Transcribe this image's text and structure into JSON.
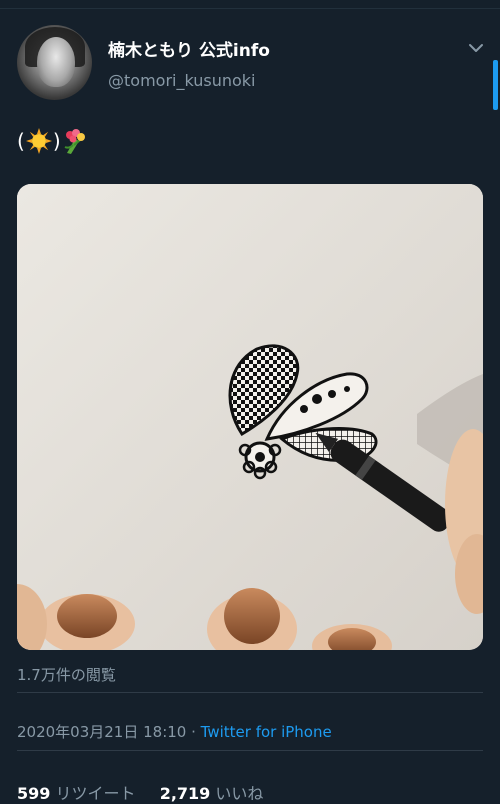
{
  "user": {
    "display_name": "楠木ともり 公式info",
    "handle": "@tomori_kusunoki"
  },
  "tweet": {
    "text_open": "(",
    "text_close": ")",
    "emojis": [
      "sun-emoji",
      "bouquet-emoji"
    ],
    "media": {
      "type": "video-thumbnail",
      "subject": "hand drawing a zentangle flower with black pen"
    },
    "views": "1.7万件の閲覧",
    "timestamp": "2020年03月21日 18:10",
    "separator": " · ",
    "source": "Twitter for iPhone"
  },
  "stats": {
    "retweets": "599",
    "retweets_label": " リツイート",
    "likes": "2,719",
    "likes_label": " いいね"
  },
  "colors": {
    "background": "#15202b",
    "accent": "#1d9bf0",
    "secondary_text": "#8899a6"
  },
  "icons": {
    "menu": "chevron-down-icon"
  }
}
